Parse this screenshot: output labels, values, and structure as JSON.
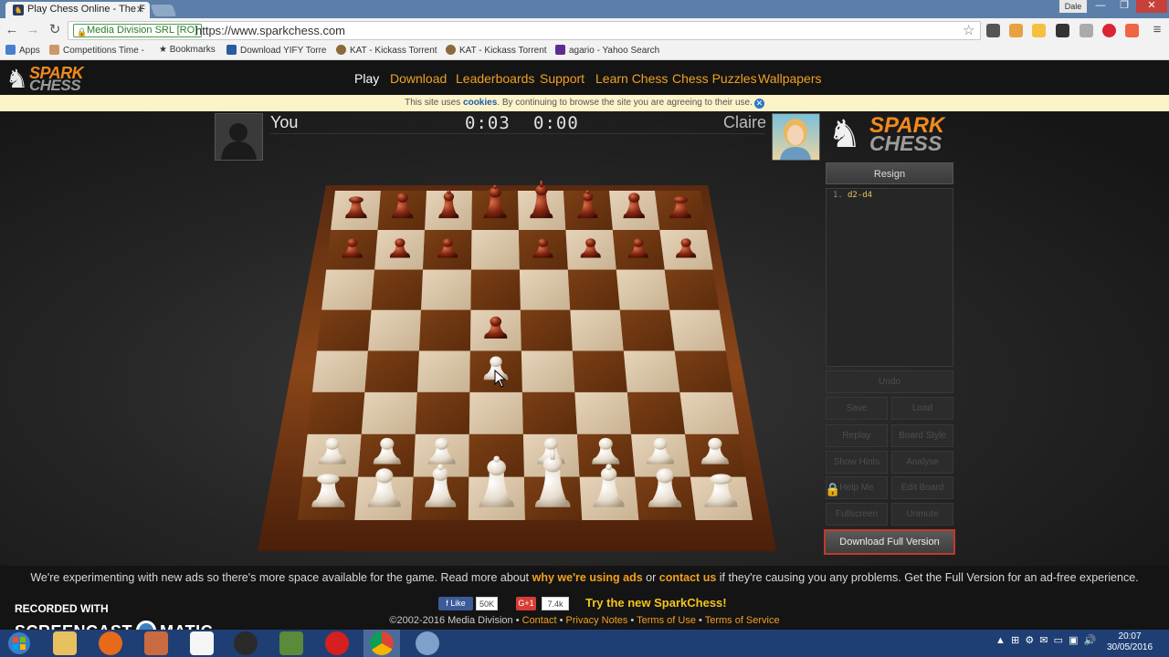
{
  "browser": {
    "tab_title": "Play Chess Online - The F",
    "tab_close": "✕",
    "user_button": "Dale",
    "window_min": "—",
    "window_max": "❐",
    "window_close": "✕",
    "security_label": "Media Division SRL [RO]",
    "url": "https://www.sparkchess.com",
    "bookmarks": [
      "Apps",
      "Competitions Time - ",
      "Bookmarks",
      "Download YIFY Torre",
      "KAT - Kickass Torrent",
      "KAT - Kickass Torrent",
      "agario - Yahoo Search"
    ]
  },
  "site": {
    "logo_top": "SPARK",
    "logo_bottom": "CHESS",
    "nav": [
      "Play",
      "Download",
      "Leaderboards",
      "Support",
      "Learn Chess",
      "Chess Puzzles",
      "Wallpapers"
    ],
    "cookie_pre": "This site uses ",
    "cookie_link": "cookies",
    "cookie_post": ". By continuing to browse the site you are agreeing to their use.",
    "cookie_close": "✕"
  },
  "game": {
    "player_you": "You",
    "player_opponent": "Claire",
    "clock_you": "0:03",
    "clock_opponent": "0:00",
    "move_number": "1.",
    "move_text": "d2-d4",
    "resign_label": "Resign",
    "buttons": {
      "undo": "Undo",
      "save": "Save",
      "load": "Load",
      "replay": "Replay",
      "board_style": "Board Style",
      "show_hints": "Show Hints",
      "analyse": "Analyse",
      "help_me": "Help Me",
      "edit_board": "Edit Board",
      "fullscreen": "Fullscreen",
      "unmute": "Unmute"
    },
    "download_full": "Download Full Version",
    "board": {
      "black_back": [
        "r",
        "n",
        "b",
        "q",
        "k",
        "b",
        "n",
        "r"
      ],
      "black_pawns_files": [
        0,
        1,
        2,
        4,
        5,
        6,
        7
      ],
      "black_advanced_pawn": {
        "file": 3,
        "rank": 5
      },
      "white_advanced_pawn": {
        "file": 3,
        "rank": 4
      },
      "white_pawns_files": [
        0,
        1,
        2,
        4,
        5,
        6,
        7
      ],
      "white_back": [
        "r",
        "n",
        "b",
        "q",
        "k",
        "b",
        "n",
        "r"
      ]
    }
  },
  "footer": {
    "ad_pre": "We're experimenting with new ads so there's more space available for the game. Read more about ",
    "ad_link1": "why we're using ads",
    "ad_mid": " or ",
    "ad_link2": "contact us",
    "ad_post": " if they're causing you any problems. Get the Full Version for an ad-free experience.",
    "fb_like": "Like",
    "fb_count": "50K",
    "gplus": "G+1",
    "gplus_count": "7.4k",
    "try_new": "Try the new SparkChess!",
    "copyright": "©2002-2016 Media Division",
    "links": [
      "Contact",
      "Privacy Notes",
      "Terms of Use",
      "Terms of Service"
    ]
  },
  "overlay": {
    "recorded_with": "RECORDED WITH",
    "screencast_a": "SCREENCAST",
    "screencast_b": "MATIC"
  },
  "taskbar": {
    "time": "20:07",
    "date": "30/05/2016"
  }
}
